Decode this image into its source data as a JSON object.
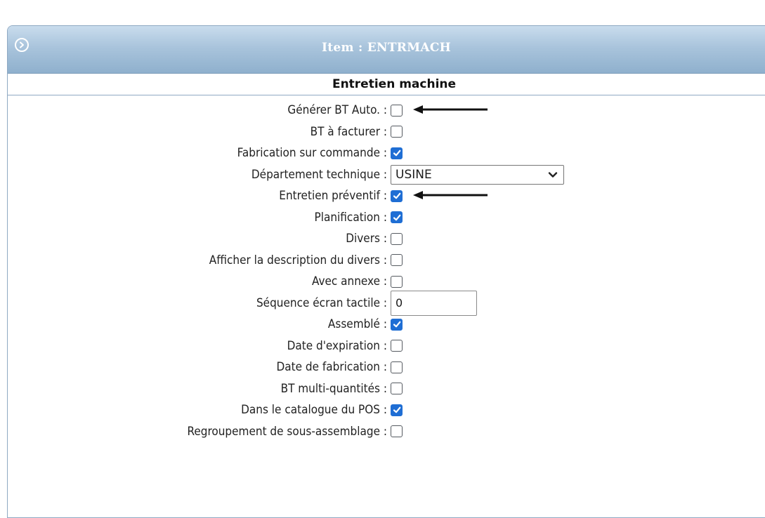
{
  "header": {
    "title": "Item :  ENTRMACH"
  },
  "section": {
    "title": "Entretien machine"
  },
  "fields": [
    {
      "label": "Générer BT Auto. :",
      "type": "checkbox",
      "checked": false,
      "arrow": true
    },
    {
      "label": "BT à facturer :",
      "type": "checkbox",
      "checked": false
    },
    {
      "label": "Fabrication sur commande :",
      "type": "checkbox",
      "checked": true
    },
    {
      "label": "Département technique :",
      "type": "select",
      "value": "USINE"
    },
    {
      "label": "Entretien préventif :",
      "type": "checkbox",
      "checked": true,
      "arrow": true
    },
    {
      "label": "Planification :",
      "type": "checkbox",
      "checked": true
    },
    {
      "label": "Divers :",
      "type": "checkbox",
      "checked": false
    },
    {
      "label": "Afficher la description du divers :",
      "type": "checkbox",
      "checked": false
    },
    {
      "label": "Avec annexe :",
      "type": "checkbox",
      "checked": false
    },
    {
      "label": "Séquence écran tactile :",
      "type": "text",
      "value": "0"
    },
    {
      "label": "Assemblé :",
      "type": "checkbox",
      "checked": true
    },
    {
      "label": "Date d'expiration :",
      "type": "checkbox",
      "checked": false
    },
    {
      "label": "Date de fabrication :",
      "type": "checkbox",
      "checked": false
    },
    {
      "label": "BT multi-quantités :",
      "type": "checkbox",
      "checked": false
    },
    {
      "label": "Dans le catalogue du POS :",
      "type": "checkbox",
      "checked": true
    },
    {
      "label": "Regroupement de sous-assemblage :",
      "type": "checkbox",
      "checked": false
    }
  ],
  "icons": {
    "header": "circle-chevron-right-icon",
    "dropdown": "chevron-down-icon",
    "annotation": "arrow-left-icon"
  },
  "colors": {
    "header_top": "#c9dced",
    "header_bottom": "#8fb0cd",
    "checkbox_checked": "#1f6ed4",
    "panel_border": "#8fa9c3"
  }
}
